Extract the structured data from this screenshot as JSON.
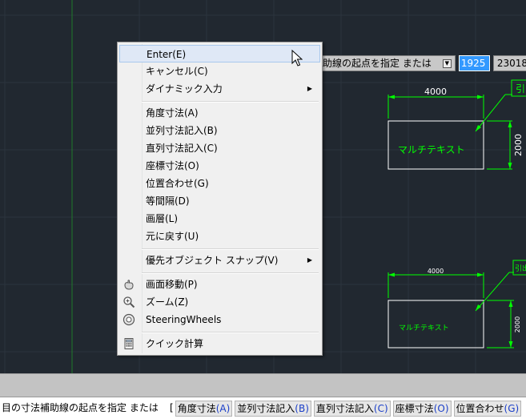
{
  "drawing": {
    "dim_top_width": "4000",
    "dim_top_height": "2000",
    "mtext_top": "マルチテキスト",
    "leader_top": "引",
    "dim_bottom_width": "4000",
    "dim_bottom_height": "2000",
    "mtext_bottom": "マルチテキスト",
    "leader_bottom": "引出"
  },
  "dynamic_input": {
    "prompt": "助線の起点を指定 または",
    "x_value": "1925",
    "y_value": "23018"
  },
  "context_menu": {
    "items": [
      {
        "label": "Enter(E)",
        "icon": "",
        "submenu": false
      },
      {
        "label": "キャンセル(C)",
        "icon": "",
        "submenu": false
      },
      {
        "label": "ダイナミック入力",
        "icon": "",
        "submenu": true
      },
      {
        "label": "角度寸法(A)",
        "icon": "",
        "submenu": false
      },
      {
        "label": "並列寸法記入(B)",
        "icon": "",
        "submenu": false
      },
      {
        "label": "直列寸法記入(C)",
        "icon": "",
        "submenu": false
      },
      {
        "label": "座標寸法(O)",
        "icon": "",
        "submenu": false
      },
      {
        "label": "位置合わせ(G)",
        "icon": "",
        "submenu": false
      },
      {
        "label": "等間隔(D)",
        "icon": "",
        "submenu": false
      },
      {
        "label": "画層(L)",
        "icon": "",
        "submenu": false
      },
      {
        "label": "元に戻す(U)",
        "icon": "",
        "submenu": false
      },
      {
        "label": "優先オブジェクト スナップ(V)",
        "icon": "",
        "submenu": true
      },
      {
        "label": "画面移動(P)",
        "icon": "pan-hand-icon",
        "submenu": false
      },
      {
        "label": "ズーム(Z)",
        "icon": "zoom-icon",
        "submenu": false
      },
      {
        "label": "SteeringWheels",
        "icon": "steering-wheel-icon",
        "submenu": false
      },
      {
        "label": "クイック計算",
        "icon": "calculator-icon",
        "submenu": false
      }
    ]
  },
  "command_line": {
    "prompt": "目の寸法補助線の起点を指定 または",
    "bracket": "[",
    "options": [
      {
        "text": "角度寸法",
        "key": "(A)"
      },
      {
        "text": "並列寸法記入",
        "key": "(B)"
      },
      {
        "text": "直列寸法記入",
        "key": "(C)"
      },
      {
        "text": "座標寸法",
        "key": "(O)"
      },
      {
        "text": "位置合わせ",
        "key": "(G)"
      }
    ]
  },
  "colors": {
    "canvas_bg": "#212830",
    "geometry": "#ffffff",
    "dimension": "#00ff00",
    "highlight": "#3399ff"
  }
}
